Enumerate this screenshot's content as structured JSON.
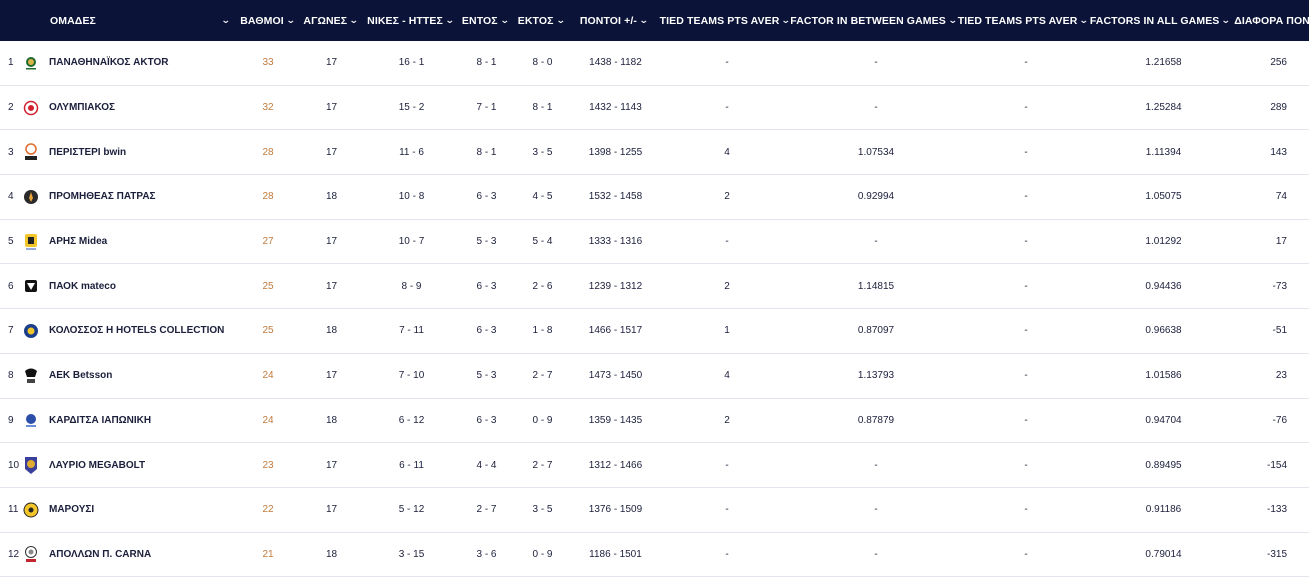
{
  "header": {
    "team": "ΟΜΑΔΕΣ",
    "points": "ΒΑΘΜΟΙ",
    "games": "ΑΓΩΝΕΣ",
    "wins_losses": "ΝΙΚΕΣ - ΗΤΤΕΣ",
    "home": "ΕΝΤΟΣ",
    "away": "ΕΚΤΟΣ",
    "points_diff": "ΠΟΝΤΟΙ +/-",
    "tied_pts_aver_1": "TIED TEAMS PTS AVER",
    "factor_between": "FACTOR IN BETWEEN GAMES",
    "tied_pts_aver_2": "TIED TEAMS PTS AVER",
    "factors_all": "FACTORS IN ALL GAMES",
    "difference": "ΔΙΑΦΟΡΑ ΠΟΝΤΩΝ"
  },
  "colors": {
    "header_bg": "#0b1438",
    "points": "#c07a3c"
  },
  "rows": [
    {
      "rank": "1",
      "team": "ΠΑΝΑΘΗΝΑΪΚΟΣ AKTOR",
      "logo": "panathinaikos-logo",
      "points": "33",
      "games": "17",
      "wl": "16 - 1",
      "home": "8 - 1",
      "away": "8 - 0",
      "pd": "1438 - 1182",
      "tt1": "-",
      "fb": "-",
      "tt2": "-",
      "fa": "1.21658",
      "diff": "256"
    },
    {
      "rank": "2",
      "team": "ΟΛΥΜΠΙΑΚΟΣ",
      "logo": "olympiacos-logo",
      "points": "32",
      "games": "17",
      "wl": "15 - 2",
      "home": "7 - 1",
      "away": "8 - 1",
      "pd": "1432 - 1143",
      "tt1": "-",
      "fb": "-",
      "tt2": "-",
      "fa": "1.25284",
      "diff": "289"
    },
    {
      "rank": "3",
      "team": "ΠΕΡΙΣΤΕΡΙ bwin",
      "logo": "peristeri-logo",
      "points": "28",
      "games": "17",
      "wl": "11 - 6",
      "home": "8 - 1",
      "away": "3 - 5",
      "pd": "1398 - 1255",
      "tt1": "4",
      "fb": "1.07534",
      "tt2": "-",
      "fa": "1.11394",
      "diff": "143"
    },
    {
      "rank": "4",
      "team": "ΠΡΟΜΗΘΕΑΣ ΠΑΤΡΑΣ",
      "logo": "promitheas-logo",
      "points": "28",
      "games": "18",
      "wl": "10 - 8",
      "home": "6 - 3",
      "away": "4 - 5",
      "pd": "1532 - 1458",
      "tt1": "2",
      "fb": "0.92994",
      "tt2": "-",
      "fa": "1.05075",
      "diff": "74"
    },
    {
      "rank": "5",
      "team": "ΑΡΗΣ Midea",
      "logo": "aris-logo",
      "points": "27",
      "games": "17",
      "wl": "10 - 7",
      "home": "5 - 3",
      "away": "5 - 4",
      "pd": "1333 - 1316",
      "tt1": "-",
      "fb": "-",
      "tt2": "-",
      "fa": "1.01292",
      "diff": "17"
    },
    {
      "rank": "6",
      "team": "ΠΑΟΚ mateco",
      "logo": "paok-logo",
      "points": "25",
      "games": "17",
      "wl": "8 - 9",
      "home": "6 - 3",
      "away": "2 - 6",
      "pd": "1239 - 1312",
      "tt1": "2",
      "fb": "1.14815",
      "tt2": "-",
      "fa": "0.94436",
      "diff": "-73"
    },
    {
      "rank": "7",
      "team": "ΚΟΛΟΣΣΟΣ H HOTELS COLLECTION",
      "logo": "kolossos-logo",
      "points": "25",
      "games": "18",
      "wl": "7 - 11",
      "home": "6 - 3",
      "away": "1 - 8",
      "pd": "1466 - 1517",
      "tt1": "1",
      "fb": "0.87097",
      "tt2": "-",
      "fa": "0.96638",
      "diff": "-51"
    },
    {
      "rank": "8",
      "team": "AEK Betsson",
      "logo": "aek-logo",
      "points": "24",
      "games": "17",
      "wl": "7 - 10",
      "home": "5 - 3",
      "away": "2 - 7",
      "pd": "1473 - 1450",
      "tt1": "4",
      "fb": "1.13793",
      "tt2": "-",
      "fa": "1.01586",
      "diff": "23"
    },
    {
      "rank": "9",
      "team": "ΚΑΡΔΙΤΣΑ ΙΑΠΩΝΙΚΗ",
      "logo": "karditsa-logo",
      "points": "24",
      "games": "18",
      "wl": "6 - 12",
      "home": "6 - 3",
      "away": "0 - 9",
      "pd": "1359 - 1435",
      "tt1": "2",
      "fb": "0.87879",
      "tt2": "-",
      "fa": "0.94704",
      "diff": "-76"
    },
    {
      "rank": "10",
      "team": "ΛΑΥΡΙΟ MEGABOLT",
      "logo": "lavrio-logo",
      "points": "23",
      "games": "17",
      "wl": "6 - 11",
      "home": "4 - 4",
      "away": "2 - 7",
      "pd": "1312 - 1466",
      "tt1": "-",
      "fb": "-",
      "tt2": "-",
      "fa": "0.89495",
      "diff": "-154"
    },
    {
      "rank": "11",
      "team": "ΜΑΡΟΥΣΙ",
      "logo": "maroussi-logo",
      "points": "22",
      "games": "17",
      "wl": "5 - 12",
      "home": "2 - 7",
      "away": "3 - 5",
      "pd": "1376 - 1509",
      "tt1": "-",
      "fb": "-",
      "tt2": "-",
      "fa": "0.91186",
      "diff": "-133"
    },
    {
      "rank": "12",
      "team": "ΑΠΟΛΛΩΝ Π. CARNA",
      "logo": "apollon-logo",
      "points": "21",
      "games": "18",
      "wl": "3 - 15",
      "home": "3 - 6",
      "away": "0 - 9",
      "pd": "1186 - 1501",
      "tt1": "-",
      "fb": "-",
      "tt2": "-",
      "fa": "0.79014",
      "diff": "-315"
    }
  ]
}
